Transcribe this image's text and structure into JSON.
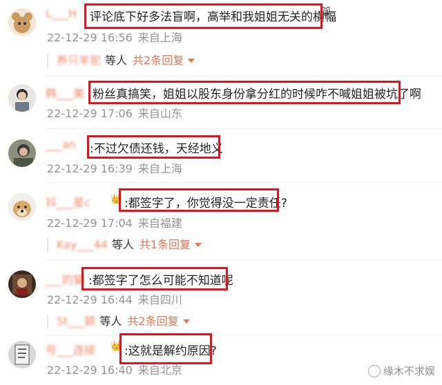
{
  "comments": [
    {
      "name": "L___H",
      "text": "评论底下好多法盲啊，高举和我姐姐无关的横幅",
      "time": "22-12-29 16:56",
      "location": "来自上海",
      "reply": {
        "name": "养只羊驼",
        "etc": "等人",
        "count": "共2条回复"
      }
    },
    {
      "name": "韩___美",
      "text": "粉丝真搞笑，姐姐以股东身份拿分红的时候咋不喊姐姐被坑了啊",
      "time": "22-12-29 17:06",
      "location": "来自山东"
    },
    {
      "name": "___an",
      "text": ":不过欠债还钱，天经地义",
      "time": "22-12-29 16:39",
      "location": "来自上海"
    },
    {
      "name": "抖___星c",
      "text": ":都签字了，你觉得没一定责任?",
      "time": "22-12-29 17:04",
      "location": "来自福建",
      "reply": {
        "name": "Kay___44",
        "etc": "等人",
        "count": "共1条回复"
      }
    },
    {
      "name": "___的猫",
      "text": ":都签字了怎么可能不知道呢",
      "time": "22-12-29 16:44",
      "location": "来自四川",
      "reply": {
        "name": "St___颖",
        "etc": "等人",
        "count": "共2条回复"
      }
    },
    {
      "name": "号___连接",
      "text": ":这就是解约原因?",
      "time": "22-12-29 16:40",
      "location": "来自北京"
    }
  ],
  "watermark": "缘木不求娱",
  "colors": {
    "accent": "#eb7350",
    "highlight": "#e0141e",
    "meta": "#939393"
  }
}
